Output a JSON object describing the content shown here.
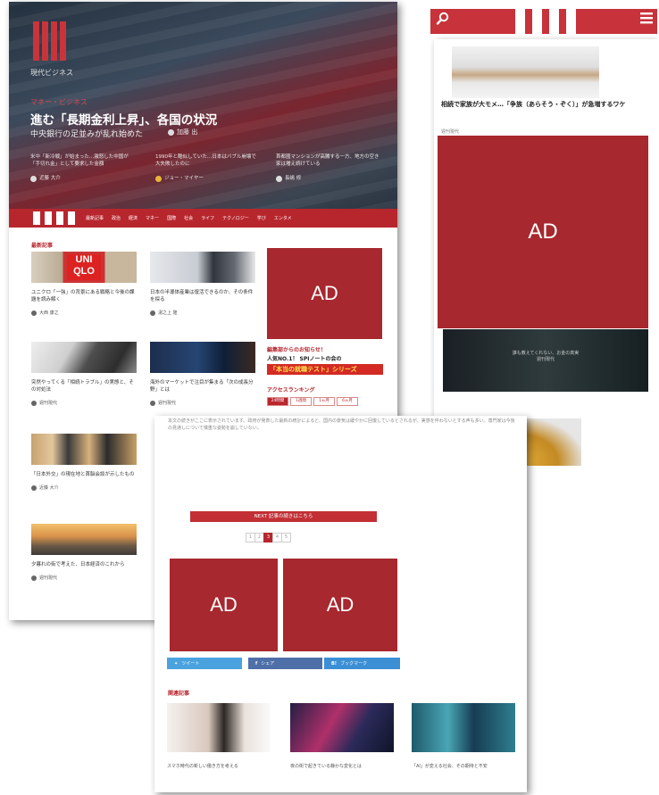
{
  "ad_label": "AD",
  "colors": {
    "brand_red": "#b8262d",
    "ad_red": "#a7282e"
  },
  "desktop": {
    "logo_text": "現代ビジネス",
    "hero": {
      "category": "マネー・ビジネス",
      "title": "進む「長期金利上昇」、各国の状況",
      "subtitle": "中央銀行の足並みが乱れ始めた",
      "author": "加藤 出",
      "subs": [
        {
          "title": "米中「新冷戦」が始まった…激怒した中国が「手切れ金」として要求した金額",
          "author": "近藤 大介"
        },
        {
          "title": "1990年と酷似していた…日本はバブル崩壊で大失敗したのに",
          "author": "ジョー・マイヤー"
        },
        {
          "title": "首都圏マンションが高騰する一方、地方の空き家は増え続けている",
          "author": "長嶋 修"
        }
      ]
    },
    "nav_items": [
      "最新記事",
      "政治",
      "経済",
      "マネー",
      "国際",
      "社会",
      "ライフ",
      "テクノロジー",
      "学び",
      "エンタメ"
    ],
    "section_label": "最新記事",
    "cards": [
      {
        "title": "ユニクロ「一強」の背景にある戦略と今後の課題を読み解く",
        "author": "大西 康之"
      },
      {
        "title": "日本の半導体産業は復活できるのか、その条件を探る",
        "author": "湯之上 隆"
      },
      {
        "title": "突然やってくる「相続トラブル」の実態と、その対処法",
        "author": "週刊現代"
      },
      {
        "title": "海外のマーケットで注目が集まる「次の成長分野」とは",
        "author": "週刊現代"
      },
      {
        "title": "「日本外交」の現在地と首脳会談が示したもの",
        "author": "近藤 大介"
      },
      {
        "title": "夕暮れの街で考えた、日本経済のこれから",
        "author": "週刊現代"
      }
    ],
    "promo": {
      "line1": "編集部からのお知らせ！",
      "line2": "人気NO.1！ SPIノートの会の",
      "line3": "「本当の就職テスト」シリーズ"
    },
    "ranking": {
      "label": "アクセスランキング",
      "tabs": [
        "24時間",
        "1週間",
        "1ヵ月",
        "6ヵ月"
      ]
    }
  },
  "mobile": {
    "menu_icon": "hamburger-icon",
    "search_icon": "search-icon",
    "article_title": "相続で家族が大モメ…「争族（あらそう・ぞく）」が急増するワケ",
    "article_sub": "週刊現代",
    "dark_caption": "誰も教えてくれない、お金の真実",
    "dark_author": "週刊現代"
  },
  "article": {
    "body": "本文の続きがここに表示されています。政府が発表した最新の統計によると、国内の景気は緩やかに回復しているとされるが、実感を伴わないとする声も多い。専門家は今後の見通しについて慎重な姿勢を崩していない。",
    "next_button": "NEXT 記事の続きはこちら",
    "pages": [
      "1",
      "2",
      "3",
      "4",
      "5"
    ],
    "active_page": 3,
    "share": {
      "twitter": "ツイート",
      "facebook": "シェア",
      "hatena": "ブックマーク"
    },
    "rec_label": "関連記事",
    "recs": [
      {
        "title": "スマホ時代の新しい働き方を考える"
      },
      {
        "title": "夜の街で起きている静かな変化とは"
      },
      {
        "title": "「AI」が変える社会、その期待と不安"
      }
    ]
  }
}
